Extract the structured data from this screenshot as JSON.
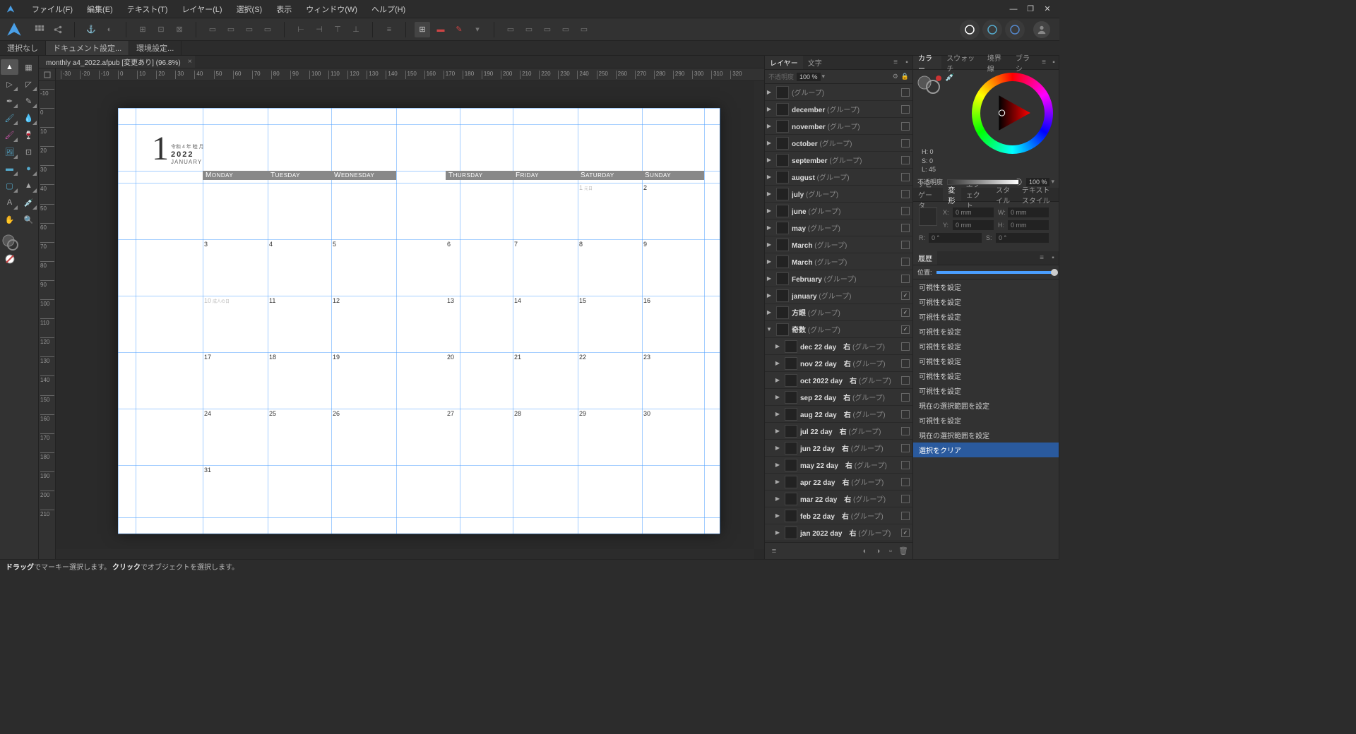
{
  "menu": {
    "file": "ファイル(F)",
    "edit": "編集(E)",
    "text": "テキスト(T)",
    "layer": "レイヤー(L)",
    "select": "選択(S)",
    "view": "表示",
    "window": "ウィンドウ(W)",
    "help": "ヘルプ(H)"
  },
  "context": {
    "nosel": "選択なし",
    "docset": "ドキュメント設定...",
    "envset": "環境設定..."
  },
  "doc": {
    "tab": "monthly a4_2022.afpub [変更あり] (96.8%)"
  },
  "panels": {
    "layers": "レイヤー",
    "text": "文字",
    "opacity_label": "不透明度",
    "opacity_val": "100 %",
    "nav": "ナビゲータ",
    "transform": "変形",
    "effect": "エフェクト",
    "style": "スタイル",
    "textstyle": "テキストスタイル",
    "color": "カラー",
    "swatch": "スウォッチ",
    "stroke": "境界線",
    "brush": "ブラシ",
    "history": "履歴",
    "pos": "位置:",
    "h": "H: 0",
    "s": "S: 0",
    "l": "L: 45",
    "op_label": "不透明度",
    "op_val": "100 %"
  },
  "transform": {
    "x": "0 mm",
    "y": "0 mm",
    "w": "0 mm",
    "h": "0 mm",
    "r1": "0 °",
    "r2": "0 °"
  },
  "layers": [
    {
      "name": "",
      "type": "(グループ)",
      "vis": false,
      "open": false
    },
    {
      "name": "december",
      "type": "(グループ)",
      "vis": false,
      "open": false
    },
    {
      "name": "november",
      "type": "(グループ)",
      "vis": false,
      "open": false
    },
    {
      "name": "october",
      "type": "(グループ)",
      "vis": false,
      "open": false
    },
    {
      "name": "september",
      "type": "(グループ)",
      "vis": false,
      "open": false
    },
    {
      "name": "august",
      "type": "(グループ)",
      "vis": false,
      "open": false
    },
    {
      "name": "july",
      "type": "(グループ)",
      "vis": false,
      "open": false
    },
    {
      "name": "june",
      "type": "(グループ)",
      "vis": false,
      "open": false
    },
    {
      "name": "may",
      "type": "(グループ)",
      "vis": false,
      "open": false
    },
    {
      "name": "March",
      "type": "(グループ)",
      "vis": false,
      "open": false
    },
    {
      "name": "March",
      "type": "(グループ)",
      "vis": false,
      "open": false
    },
    {
      "name": "February",
      "type": "(グループ)",
      "vis": false,
      "open": false
    },
    {
      "name": "january",
      "type": "(グループ)",
      "vis": true,
      "open": false
    },
    {
      "name": "方眼",
      "type": "(グループ)",
      "vis": true,
      "open": false
    },
    {
      "name": "奇数",
      "type": "(グループ)",
      "vis": true,
      "open": true
    }
  ],
  "sublayers": [
    {
      "name": "dec 22 day　右",
      "type": "(グループ)",
      "vis": false
    },
    {
      "name": "nov 22 day　右",
      "type": "(グループ)",
      "vis": false
    },
    {
      "name": "oct 2022 day　右",
      "type": "(グループ)",
      "vis": false
    },
    {
      "name": "sep 22 day　右",
      "type": "(グループ)",
      "vis": false
    },
    {
      "name": "aug 22 day　右",
      "type": "(グループ)",
      "vis": false
    },
    {
      "name": "jul 22 day　右",
      "type": "(グループ)",
      "vis": false
    },
    {
      "name": "jun 22 day　右",
      "type": "(グループ)",
      "vis": false
    },
    {
      "name": "may 22 day　右",
      "type": "(グループ)",
      "vis": false
    },
    {
      "name": "apr 22 day　右",
      "type": "(グループ)",
      "vis": false
    },
    {
      "name": "mar 22 day　右",
      "type": "(グループ)",
      "vis": false
    },
    {
      "name": "feb 22 day　右",
      "type": "(グループ)",
      "vis": false
    },
    {
      "name": "jan 2022 day　右",
      "type": "(グループ)",
      "vis": true
    }
  ],
  "history": [
    "可視性を設定",
    "可視性を設定",
    "可視性を設定",
    "可視性を設定",
    "可視性を設定",
    "可視性を設定",
    "可視性を設定",
    "可視性を設定",
    "現在の選択範囲を設定",
    "可視性を設定",
    "現在の選択範囲を設定",
    "選択をクリア"
  ],
  "calendar": {
    "num": "1",
    "sub": "令和 4 年 睦 月",
    "year": "2022",
    "name": "JANUARY",
    "dow": [
      "MONDAY",
      "TUESDAY",
      "WEDNESDAY",
      "THURSDAY",
      "FRIDAY",
      "SATURDAY",
      "SUNDAY"
    ],
    "n_1": "1",
    "n_1_note": "元日",
    "n_2": "2",
    "r1": [
      "3",
      "4",
      "5",
      "6",
      "7",
      "8",
      "9"
    ],
    "r2": [
      "10",
      "11",
      "12",
      "13",
      "14",
      "15",
      "16"
    ],
    "r2_note": "成人の日",
    "r3": [
      "17",
      "18",
      "19",
      "20",
      "21",
      "22",
      "23"
    ],
    "r4": [
      "24",
      "25",
      "26",
      "27",
      "28",
      "29",
      "30"
    ],
    "r5": [
      "31"
    ]
  },
  "status": {
    "a": "ドラッグ",
    "b": "でマーキー選択します。",
    "c": "クリック",
    "d": "でオブジェクトを選択します。"
  },
  "ruler_unit": "mm"
}
